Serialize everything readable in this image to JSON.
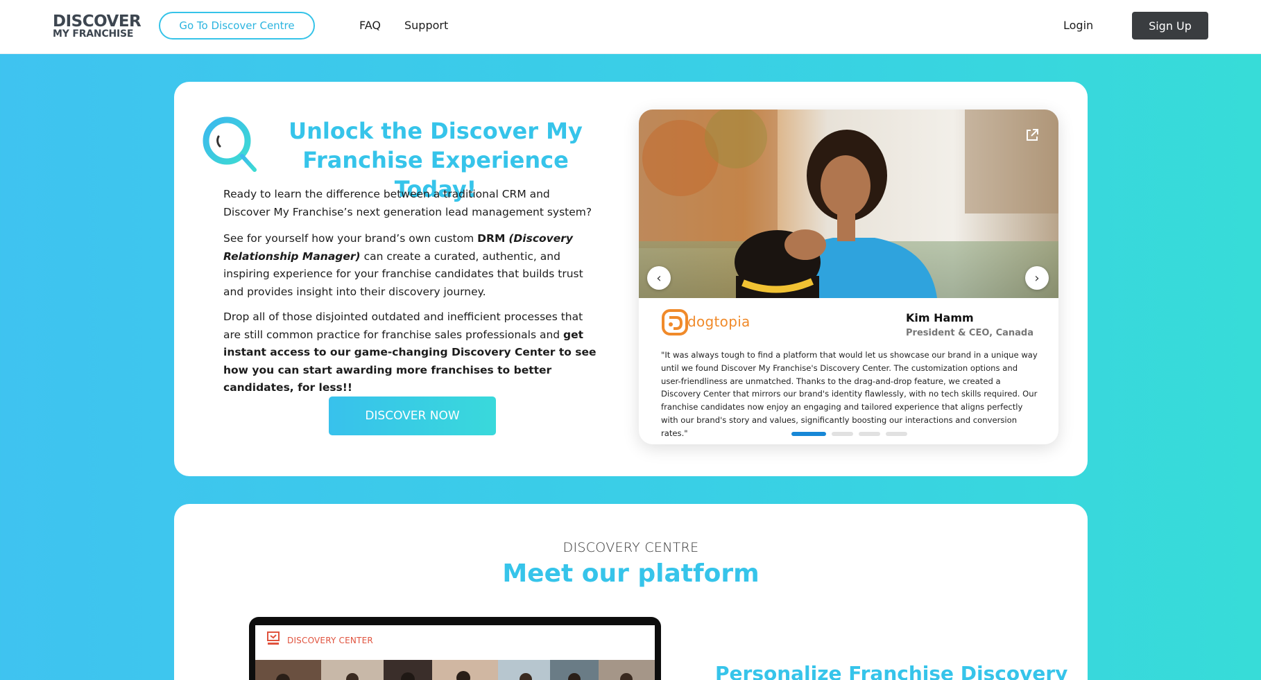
{
  "header": {
    "logo_line1": "DISCOVER",
    "logo_line2": "MY FRANCHISE",
    "discover_centre_button": "Go To Discover Centre",
    "nav": [
      "FAQ",
      "Support"
    ],
    "login": "Login",
    "signup": "Sign Up"
  },
  "hero": {
    "title": "Unlock the Discover My Franchise Experience Today!",
    "p1": "Ready to learn the difference between a traditional CRM and Discover My Franchise’s next generation lead management system?",
    "p2_a": "See for yourself how your brand’s own custom ",
    "p2_b": "DRM",
    "p2_c": "(Discovery Relationship Manager)",
    "p2_d": " can create a curated, authentic, and inspiring experience for your franchise candidates that builds trust and provides insight into their discovery journey.",
    "p3_a": "Drop all of those disjointed outdated and inefficient processes that are still common practice for franchise sales professionals and ",
    "p3_b": "get instant access to our game-changing Discovery Center to see how you can start awarding more franchises to better candidates, for less!!",
    "cta": "DISCOVER NOW"
  },
  "testimonial": {
    "brand": "dogtopia",
    "name": "Kim Hamm",
    "role": "President & CEO, Canada",
    "quote": "\"It was always tough to find a platform that would let us showcase our brand in a unique way until we found Discover My Franchise's Discovery Center. The customization options and user-friendliness are unmatched. Thanks to the drag-and-drop feature, we created a Discovery Center that mirrors our brand's identity flawlessly, with no tech skills required. Our franchise candidates now enjoy an engaging and tailored experience that aligns perfectly with our brand's story and values, significantly boosting our interactions and conversion rates.\"",
    "prev_arrow": "‹",
    "next_arrow": "›",
    "active_slide": 1,
    "slide_count": 4
  },
  "platform": {
    "eyebrow": "DISCOVERY CENTRE",
    "title": "Meet our platform",
    "screen_title": "DISCOVERY CENTER",
    "subhead": "Personalize Franchise Discovery"
  },
  "colors": {
    "accent": "#36c4ea",
    "signup_bg": "#3a3d40",
    "brand_orange": "#f08a2a"
  }
}
